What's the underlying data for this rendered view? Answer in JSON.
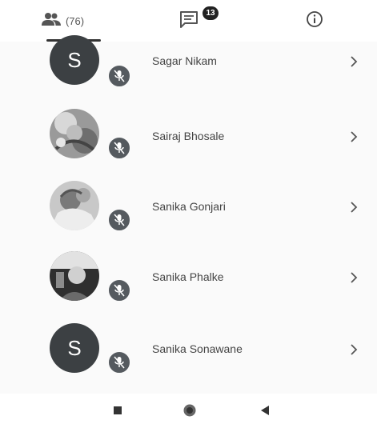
{
  "tabs": {
    "participants_count": "(76)",
    "chat_badge": "13"
  },
  "icons": {
    "participants": "people-icon",
    "chat": "chat-icon",
    "info": "info-icon",
    "mic": "mic-off-icon",
    "chevron": "chevron-right-icon",
    "nav_recent": "square-icon",
    "nav_home": "circle-icon",
    "nav_back": "back-triangle-icon"
  },
  "participants": [
    {
      "name": "Sagar Nikam",
      "initial": "S",
      "avatar_type": "letter"
    },
    {
      "name": "Sairaj Bhosale",
      "initial": "",
      "avatar_type": "photo"
    },
    {
      "name": "Sanika Gonjari",
      "initial": "",
      "avatar_type": "photo"
    },
    {
      "name": "Sanika Phalke",
      "initial": "",
      "avatar_type": "photo"
    },
    {
      "name": "Sanika Sonawane",
      "initial": "S",
      "avatar_type": "letter"
    }
  ],
  "colors": {
    "letter_avatar_bg": "#3c4043",
    "mic_badge_bg": "#555a5f",
    "badge_bg": "#222222"
  }
}
